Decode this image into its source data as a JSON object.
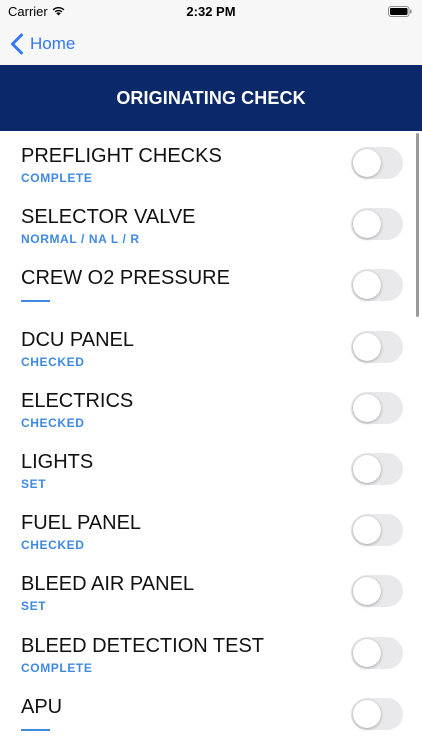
{
  "status_bar": {
    "carrier": "Carrier",
    "time": "2:32 PM",
    "wifi_icon": "wifi-icon",
    "battery_icon": "battery-icon"
  },
  "nav": {
    "back_label": "Home",
    "back_icon": "chevron-left-icon"
  },
  "header": {
    "title": "ORIGINATING CHECK"
  },
  "colors": {
    "accent": "#3478f6",
    "banner": "#0b2968",
    "status": "#3f8ae0",
    "toggle_off": "#e9e9eb"
  },
  "items": [
    {
      "title": "PREFLIGHT CHECKS",
      "status": "COMPLETE",
      "on": false
    },
    {
      "title": "SELECTOR VALVE",
      "status": "NORMAL / NA L / R",
      "on": false
    },
    {
      "title": "CREW O2 PRESSURE",
      "status": "",
      "on": false
    },
    {
      "title": "DCU PANEL",
      "status": "CHECKED",
      "on": false
    },
    {
      "title": "ELECTRICS",
      "status": "CHECKED",
      "on": false
    },
    {
      "title": "LIGHTS",
      "status": "SET",
      "on": false
    },
    {
      "title": "FUEL PANEL",
      "status": "CHECKED",
      "on": false
    },
    {
      "title": "BLEED AIR PANEL",
      "status": "SET",
      "on": false
    },
    {
      "title": "BLEED DETECTION TEST",
      "status": "COMPLETE",
      "on": false
    },
    {
      "title": "APU",
      "status": "",
      "on": false
    }
  ]
}
